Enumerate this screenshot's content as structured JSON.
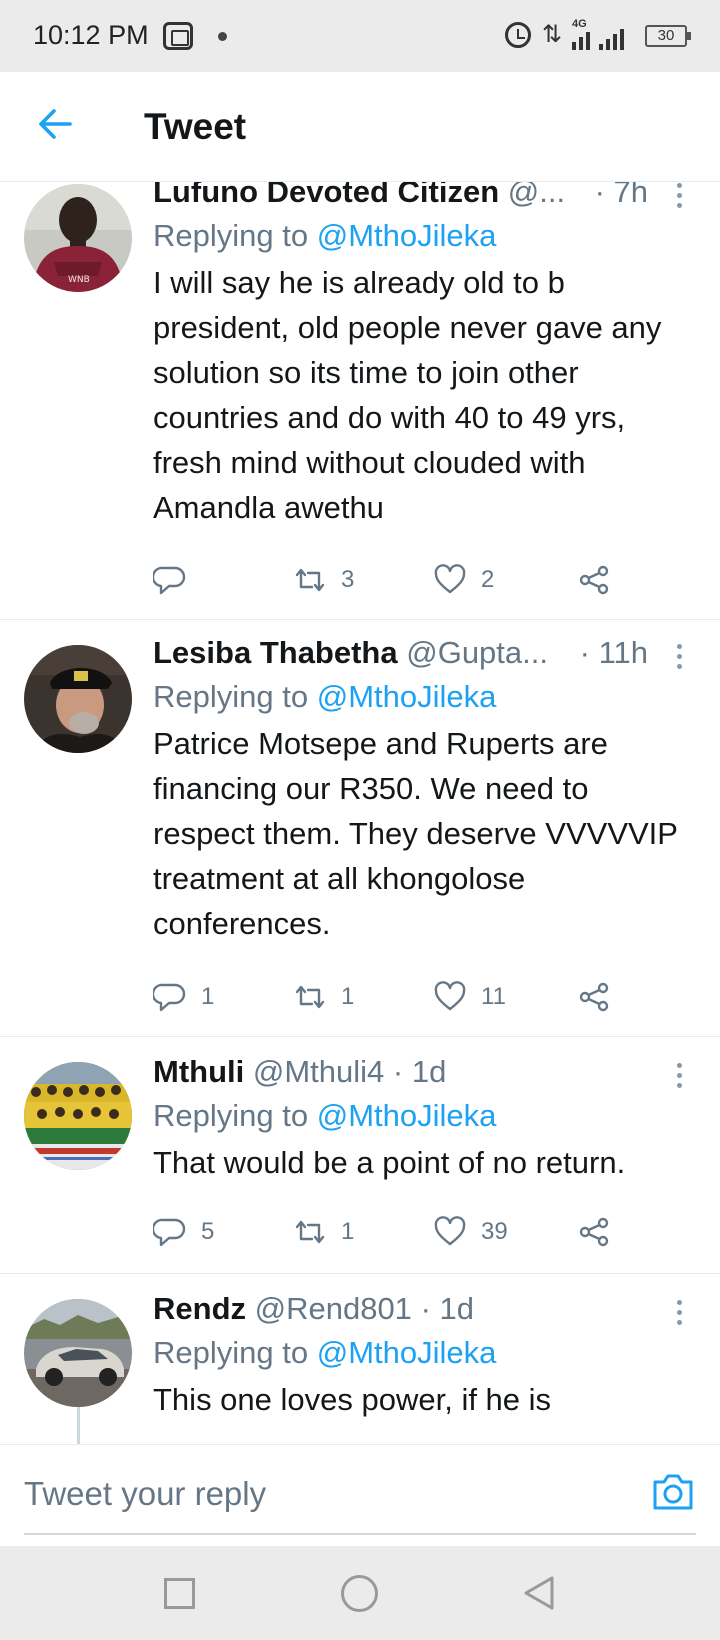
{
  "status_bar": {
    "time": "10:12 PM",
    "network": "4G",
    "battery": "30",
    "icons": [
      "app-icon",
      "dot-icon",
      "alarm-icon",
      "data-arrows-icon",
      "signal-icon",
      "battery-icon"
    ]
  },
  "header": {
    "back_icon": "back-arrow-icon",
    "title": "Tweet"
  },
  "accent_color": "#1da1f2",
  "tweets": [
    {
      "name": "Lufuno Devoted Citizen",
      "handle": "@...",
      "time": "· 7h",
      "replying_label": "Replying to",
      "replying_to": "@MthoJileka",
      "text": "I will say he is already old to b president, old people never gave any solution so its time to join other countries and do with 40 to 49 yrs, fresh mind without clouded with Amandla awethu",
      "replies": "",
      "retweets": "3",
      "likes": "2"
    },
    {
      "name": "Lesiba Thabetha",
      "handle": "@Gupta...",
      "time": "· 11h",
      "replying_label": "Replying to",
      "replying_to": "@MthoJileka",
      "text": "Patrice Motsepe and Ruperts are financing our R350. We need to respect them. They deserve VVVVVIP treatment at all khongolose conferences.",
      "replies": "1",
      "retweets": "1",
      "likes": "11"
    },
    {
      "name": "Mthuli",
      "handle": "@Mthuli4",
      "time": "· 1d",
      "replying_label": "Replying to",
      "replying_to": "@MthoJileka",
      "text": "That would be a point of no return.",
      "replies": "5",
      "retweets": "1",
      "likes": "39"
    },
    {
      "name": "Rendz",
      "handle": "@Rend801",
      "time": "· 1d",
      "replying_label": "Replying to",
      "replying_to": "@MthoJileka",
      "text": "This one loves power, if he is",
      "replies": "",
      "retweets": "",
      "likes": ""
    }
  ],
  "reply_bar": {
    "placeholder": "Tweet your reply",
    "camera_icon": "camera-icon"
  },
  "nav_bar": {
    "icons": [
      "recents-square-icon",
      "home-circle-icon",
      "back-triangle-icon"
    ]
  }
}
